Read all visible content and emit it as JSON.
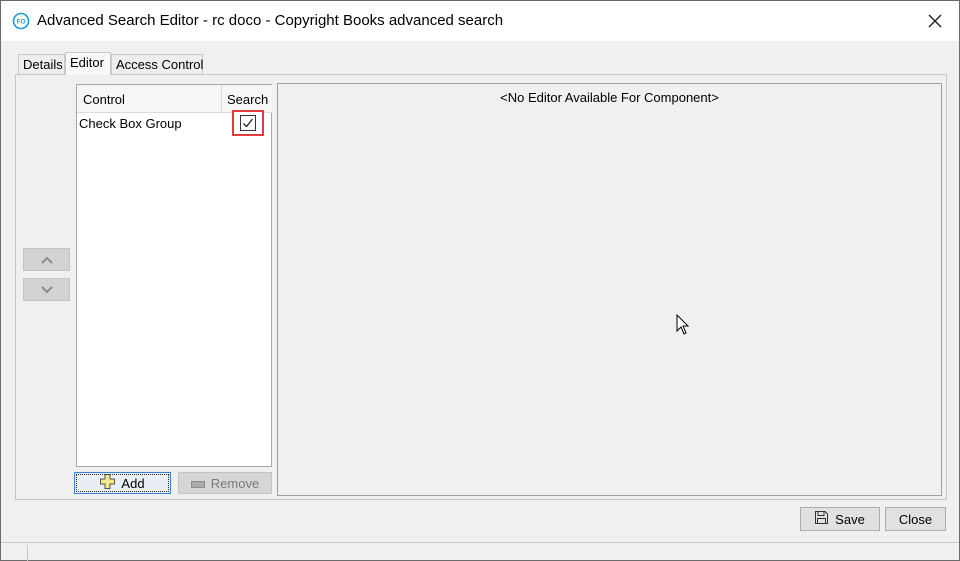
{
  "window": {
    "title": "Advanced Search Editor - rc doco - Copyright Books advanced search",
    "app_icon": "fo-logo-icon",
    "close_icon": "close-icon"
  },
  "tabs": [
    {
      "label": "Details",
      "active": false
    },
    {
      "label": "Editor",
      "active": true
    },
    {
      "label": "Access Control",
      "active": false
    }
  ],
  "move_buttons": {
    "up_icon": "chevron-up-icon",
    "down_icon": "chevron-down-icon"
  },
  "table": {
    "columns": [
      "Control",
      "Search"
    ],
    "rows": [
      {
        "control": "Check Box Group",
        "search": true
      }
    ]
  },
  "actions": {
    "add_label": "Add",
    "add_icon": "plus-icon",
    "remove_label": "Remove",
    "remove_icon": "minus-icon"
  },
  "editor": {
    "message": "<No Editor Available For Component>"
  },
  "footer": {
    "save_label": "Save",
    "save_icon": "floppy-disk-icon",
    "close_label": "Close"
  },
  "colors": {
    "highlight": "#e23b3b",
    "focus_border": "#3c7fd6",
    "icon_teal": "#1a9bd7"
  }
}
